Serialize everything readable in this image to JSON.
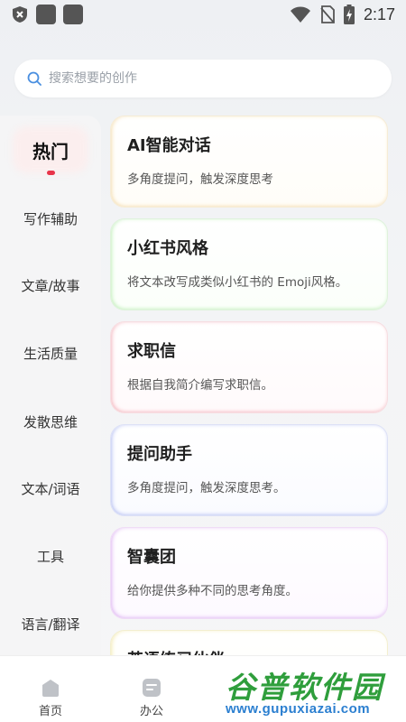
{
  "status_bar": {
    "time": "2:17"
  },
  "search": {
    "placeholder": "搜索想要的创作",
    "value": ""
  },
  "sidebar": {
    "items": [
      {
        "label": "热门",
        "active": true
      },
      {
        "label": "写作辅助"
      },
      {
        "label": "文章/故事"
      },
      {
        "label": "生活质量"
      },
      {
        "label": "发散思维"
      },
      {
        "label": "文本/词语"
      },
      {
        "label": "工具"
      },
      {
        "label": "语言/翻译"
      }
    ],
    "accent": "#e8344a"
  },
  "cards": [
    {
      "title": "AI智能对话",
      "desc": "多角度提问，触发深度思考"
    },
    {
      "title": "小红书风格",
      "desc": "将文本改写成类似小红书的 Emoji风格。"
    },
    {
      "title": "求职信",
      "desc": "根据自我简介编写求职信。"
    },
    {
      "title": "提问助手",
      "desc": "多角度提问，触发深度思考。"
    },
    {
      "title": "智囊团",
      "desc": "给你提供多种不同的思考角度。"
    },
    {
      "title": "英语练习伙伴",
      "desc": ""
    }
  ],
  "bottom_nav": {
    "items": [
      {
        "label": "首页",
        "icon": "home-icon"
      },
      {
        "label": "办公",
        "icon": "office-icon"
      }
    ]
  },
  "watermark": {
    "title": "谷普软件园",
    "url": "www.gupuxiazai.com"
  }
}
